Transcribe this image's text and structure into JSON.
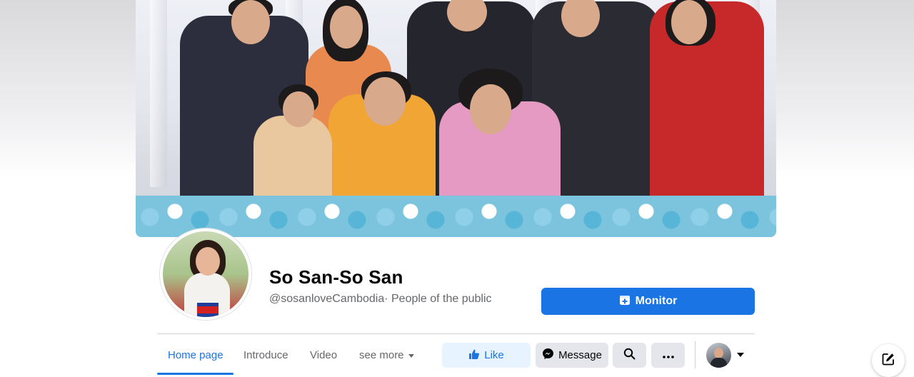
{
  "page": {
    "name": "So San-So San",
    "handle": "@sosanloveCambodia",
    "category": "· People of the public",
    "monitor_label": "Monitor"
  },
  "tabs": [
    {
      "label": "Home page",
      "active": true
    },
    {
      "label": "Introduce",
      "active": false
    },
    {
      "label": "Video",
      "active": false
    },
    {
      "label": "see more",
      "active": false
    }
  ],
  "actions": {
    "like_label": "Like",
    "message_label": "Message"
  },
  "colors": {
    "accent": "#1b74e4",
    "like_bg": "#e7f3ff",
    "button_gray": "#e4e6eb",
    "text_secondary": "#65676b"
  },
  "icons": {
    "monitor": "box-plus-icon",
    "like": "thumbs-up-icon",
    "message": "messenger-icon",
    "search": "search-icon",
    "more": "ellipsis-icon",
    "account": "chevron-down-icon",
    "compose": "edit-icon"
  }
}
